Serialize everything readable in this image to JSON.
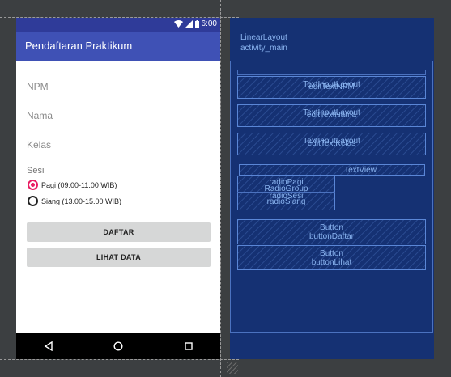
{
  "design": {
    "status_time": "6:00",
    "app_title": "Pendaftaran Praktikum",
    "fields": [
      {
        "hint": "NPM"
      },
      {
        "hint": "Nama"
      },
      {
        "hint": "Kelas"
      }
    ],
    "sesi_label": "Sesi",
    "radios": [
      {
        "label": "Pagi (09.00-11.00 WIB)",
        "checked": true
      },
      {
        "label": "Siang (13.00-15.00 WIB)",
        "checked": false
      }
    ],
    "buttons": {
      "daftar": "DAFTAR",
      "lihat": "LIHAT DATA"
    },
    "nav": {
      "back_icon": "back-triangle-icon",
      "home_icon": "home-circle-icon",
      "recents_icon": "recents-square-icon"
    }
  },
  "blueprint": {
    "root_type": "LinearLayout",
    "root_id": "activity_main",
    "inputs": [
      {
        "type": "TextInputLayout",
        "id": "editTextNPM"
      },
      {
        "type": "TextInputLayout",
        "id": "editTextNama"
      },
      {
        "type": "TextInputLayout",
        "id": "editTextKelas"
      }
    ],
    "textview": "TextView",
    "radio_pagi": "radioPagi",
    "radiogroup_type": "RadioGroup",
    "radiogroup_id": "radioSesi",
    "radio_siang": "radioSiang",
    "button_daftar": {
      "type": "Button",
      "id": "buttonDaftar"
    },
    "button_lihat": {
      "type": "Button",
      "id": "buttonLihat"
    }
  },
  "colors": {
    "primary": "#3f51b5",
    "primary_dark": "#2f3b99",
    "accent": "#e91e63",
    "blueprint_bg": "#153173",
    "canvas_bg": "#3c3f41"
  }
}
